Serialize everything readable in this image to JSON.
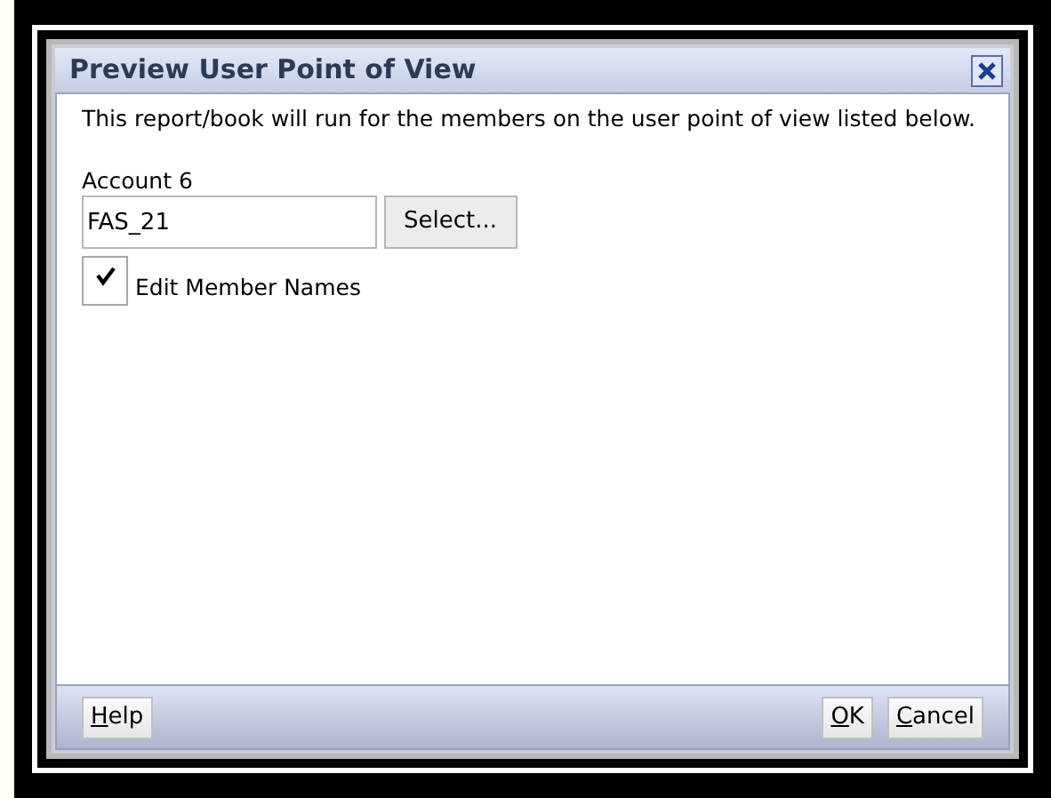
{
  "window": {
    "title": "Preview User Point of View"
  },
  "message": "This report/book will run for the members on the user point of view listed below.",
  "field": {
    "label": "Account 6",
    "value": "FAS_21",
    "button": "Select..."
  },
  "checkbox": {
    "label": "Edit Member Names",
    "checked": true
  },
  "footer_left": [
    {
      "label": "Help",
      "underline_first": true
    }
  ],
  "footer_right": [
    {
      "label": "OK",
      "underline_first": true
    },
    {
      "label": "Cancel",
      "underline_first": true
    }
  ]
}
